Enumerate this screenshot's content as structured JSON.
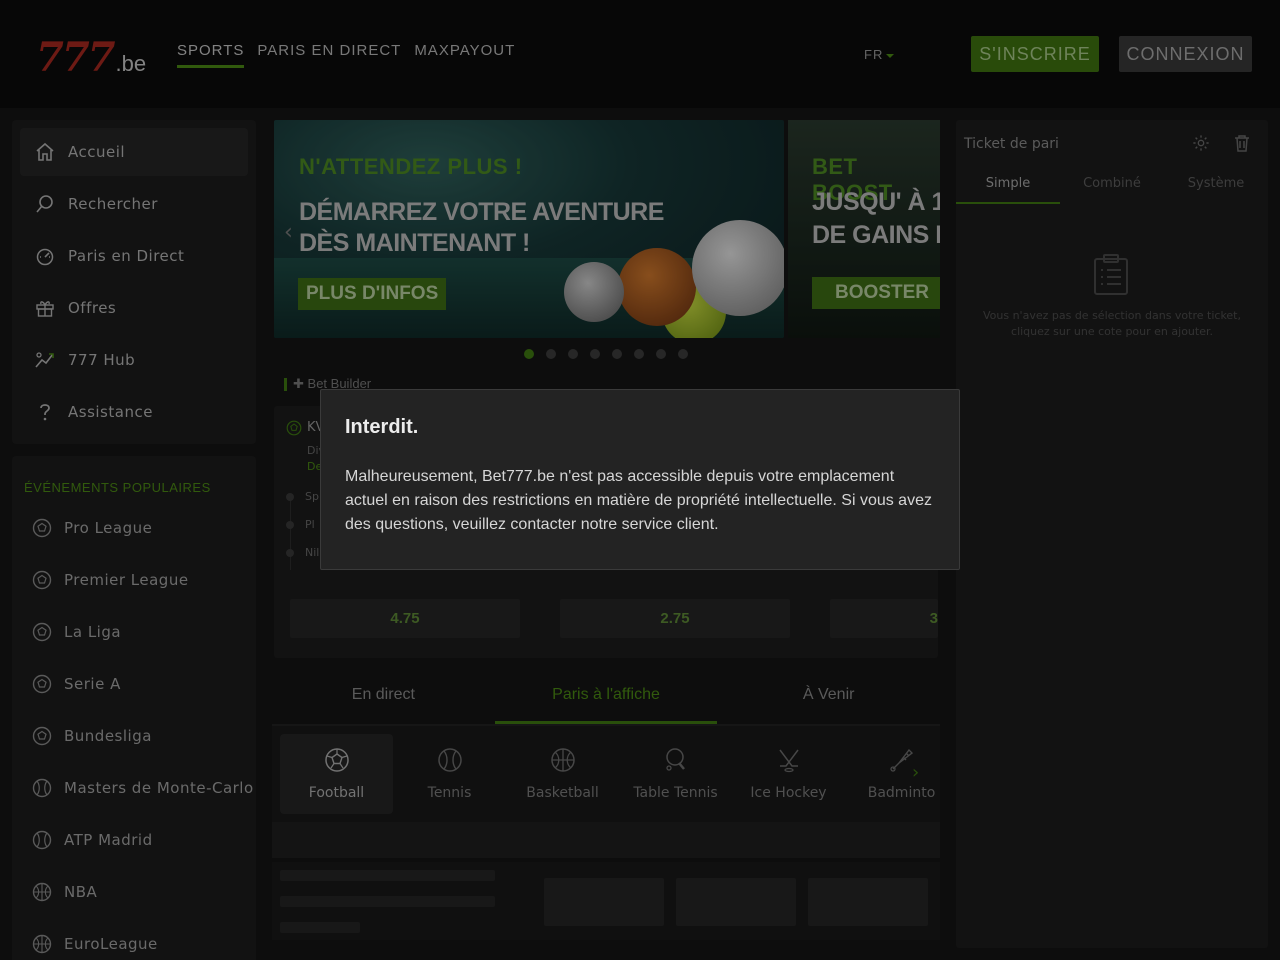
{
  "header": {
    "logo_number": "777",
    "logo_suffix": ".be",
    "nav": [
      "SPORTS",
      "PARIS EN DIRECT",
      "MAXPAYOUT"
    ],
    "language": "FR",
    "signup_label": "S'INSCRIRE",
    "login_label": "CONNEXION"
  },
  "sidebar": {
    "items": [
      {
        "label": "Accueil",
        "icon": "home-icon"
      },
      {
        "label": "Rechercher",
        "icon": "search-icon"
      },
      {
        "label": "Paris en Direct",
        "icon": "speedometer-icon"
      },
      {
        "label": "Offres",
        "icon": "gift-icon"
      },
      {
        "label": "777 Hub",
        "icon": "hub-icon"
      },
      {
        "label": "Assistance",
        "icon": "help-icon"
      }
    ],
    "popular_title": "ÉVÉNEMENTS POPULAIRES",
    "popular": [
      {
        "label": "Pro League",
        "icon": "football-icon"
      },
      {
        "label": "Premier League",
        "icon": "football-icon"
      },
      {
        "label": "La Liga",
        "icon": "football-icon"
      },
      {
        "label": "Serie A",
        "icon": "football-icon"
      },
      {
        "label": "Bundesliga",
        "icon": "football-icon"
      },
      {
        "label": "Masters de Monte-Carlo",
        "icon": "tennis-icon"
      },
      {
        "label": "ATP Madrid",
        "icon": "tennis-icon"
      },
      {
        "label": "NBA",
        "icon": "basketball-icon"
      },
      {
        "label": "EuroLeague",
        "icon": "basketball-icon"
      }
    ]
  },
  "banners": {
    "banner1": {
      "headline": "N'ATTENDEZ PLUS !",
      "line1": "DÉMARREZ VOTRE AVENTURE",
      "line2": "DÈS MAINTENANT !",
      "button": "PLUS D'INFOS"
    },
    "banner2": {
      "headline": "BET BOOST",
      "line1": "JUSQU' À 1",
      "line2": "DE GAINS E",
      "button": "BOOSTER"
    },
    "dot_count": 8,
    "active_dot": 0
  },
  "bet_builder": {
    "label": "Bet Builder",
    "title": "KV",
    "line1": "Div",
    "line2": "De",
    "rows": [
      "Sp",
      "Pl",
      "Nil"
    ],
    "odds": [
      "4.75",
      "2.75",
      "3"
    ]
  },
  "tabs": [
    {
      "label": "En direct",
      "active": false
    },
    {
      "label": "Paris à l'affiche",
      "active": true
    },
    {
      "label": "À Venir",
      "active": false
    }
  ],
  "sports": [
    {
      "label": "Football",
      "icon": "football-icon",
      "active": true
    },
    {
      "label": "Tennis",
      "icon": "tennis-icon",
      "active": false
    },
    {
      "label": "Basketball",
      "icon": "basketball-icon",
      "active": false
    },
    {
      "label": "Table Tennis",
      "icon": "table-tennis-icon",
      "active": false
    },
    {
      "label": "Ice Hockey",
      "icon": "ice-hockey-icon",
      "active": false
    },
    {
      "label": "Badminto",
      "icon": "badminton-icon",
      "active": false
    }
  ],
  "bet_slip": {
    "title": "Ticket de pari",
    "tabs": [
      "Simple",
      "Combiné",
      "Système"
    ],
    "empty_text": "Vous n'avez pas de sélection dans votre ticket, cliquez sur une cote pour en ajouter."
  },
  "modal": {
    "title": "Interdit.",
    "body": "Malheureusement, Bet777.be n'est pas accessible depuis votre emplacement actuel en raison des restrictions en matière de propriété intellectuelle. Si vous avez des questions, veuillez contacter notre service client."
  },
  "colors": {
    "accent": "#3f7a12",
    "logo_red": "#a8281f",
    "background": "#141414"
  }
}
